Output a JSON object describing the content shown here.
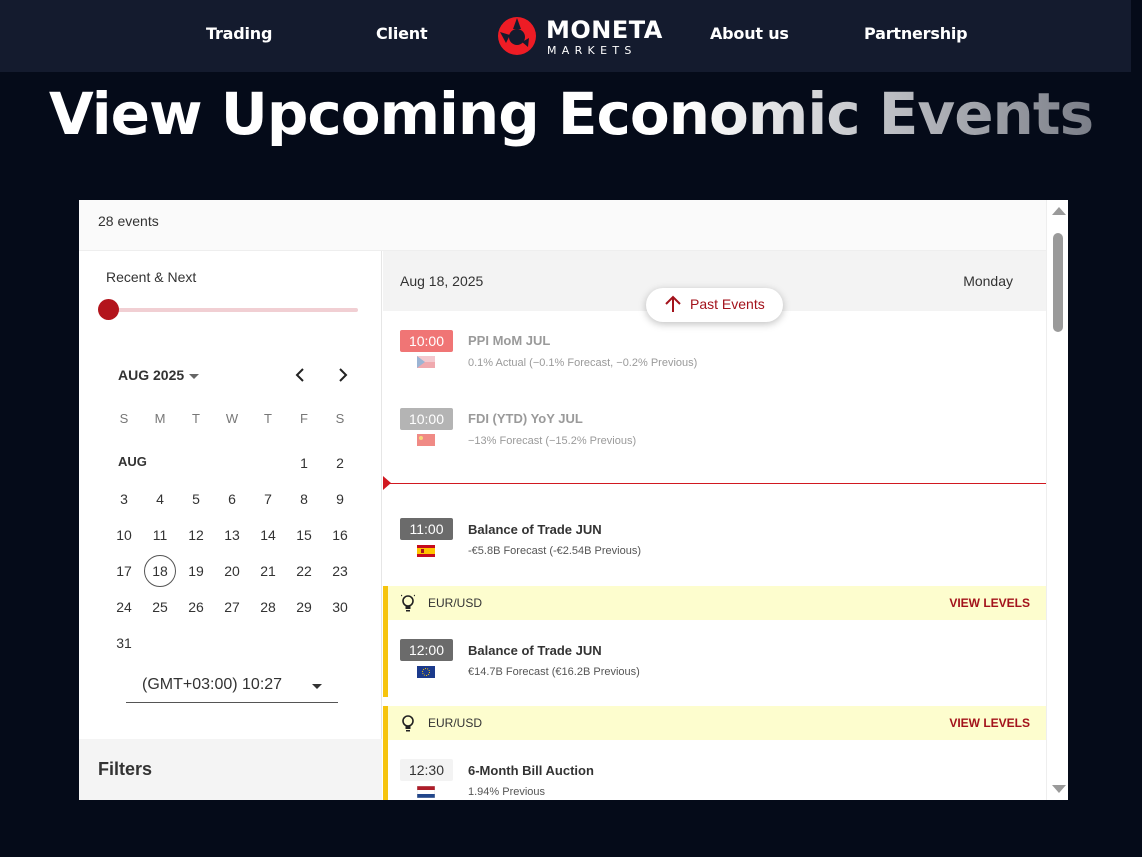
{
  "nav": {
    "links": [
      "Trading",
      "Client",
      "About us",
      "Partnership"
    ],
    "logo_word": "MONETA",
    "logo_sub": "MARKETS",
    "brand_color": "#ee1c25"
  },
  "hero": {
    "title": "View Upcoming Economic Events"
  },
  "widget": {
    "events_count": "28 events",
    "range_label": "Recent & Next",
    "calendar": {
      "month_label": "AUG 2025",
      "prev_icon": "chevron-left-icon",
      "next_icon": "chevron-right-icon",
      "weekdays": [
        "S",
        "M",
        "T",
        "W",
        "T",
        "F",
        "S"
      ],
      "month_short": "AUG",
      "days": [
        "1",
        "2",
        "3",
        "4",
        "5",
        "6",
        "7",
        "8",
        "9",
        "10",
        "11",
        "12",
        "13",
        "14",
        "15",
        "16",
        "17",
        "18",
        "19",
        "20",
        "21",
        "22",
        "23",
        "24",
        "25",
        "26",
        "27",
        "28",
        "29",
        "30",
        "31"
      ],
      "selected_day": "18"
    },
    "timezone": "(GMT+03:00) 10:27",
    "filters_title": "Filters",
    "date_header": {
      "date": "Aug 18, 2025",
      "day": "Monday"
    },
    "past_events_label": "Past Events",
    "events": [
      {
        "time": "10:00",
        "title": "PPI MoM JUL",
        "sub": "0.1% Actual (−0.1% Forecast, −0.2% Previous)",
        "flag": "czech-flag-icon",
        "past": true,
        "time_bg": "#f07575"
      },
      {
        "time": "10:00",
        "title": "FDI (YTD) YoY JUL",
        "sub": "−13% Forecast (−15.2% Previous)",
        "flag": "china-flag-icon",
        "past": true,
        "time_bg": "#b4b4b4"
      },
      {
        "time": "11:00",
        "title": "Balance of Trade JUN",
        "sub": "-€5.8B Forecast (-€2.54B Previous)",
        "flag": "spain-flag-icon",
        "past": false,
        "time_bg": "#6b6b6b"
      },
      {
        "time": "12:00",
        "title": "Balance of Trade JUN",
        "sub": "€14.7B Forecast (€16.2B Previous)",
        "flag": "eu-flag-icon",
        "past": false,
        "time_bg": "#6b6b6b"
      },
      {
        "time": "12:30",
        "title": "6-Month Bill Auction",
        "sub": "1.94% Previous",
        "flag": "netherlands-flag-icon",
        "past": false,
        "time_bg": "#f3f3f3"
      }
    ],
    "pair_cards": [
      {
        "pair": "EUR/USD",
        "action": "VIEW LEVELS"
      },
      {
        "pair": "EUR/USD",
        "action": "VIEW LEVELS"
      }
    ],
    "accent_color": "#a3121b",
    "highlight_color": "#f6c40e"
  }
}
